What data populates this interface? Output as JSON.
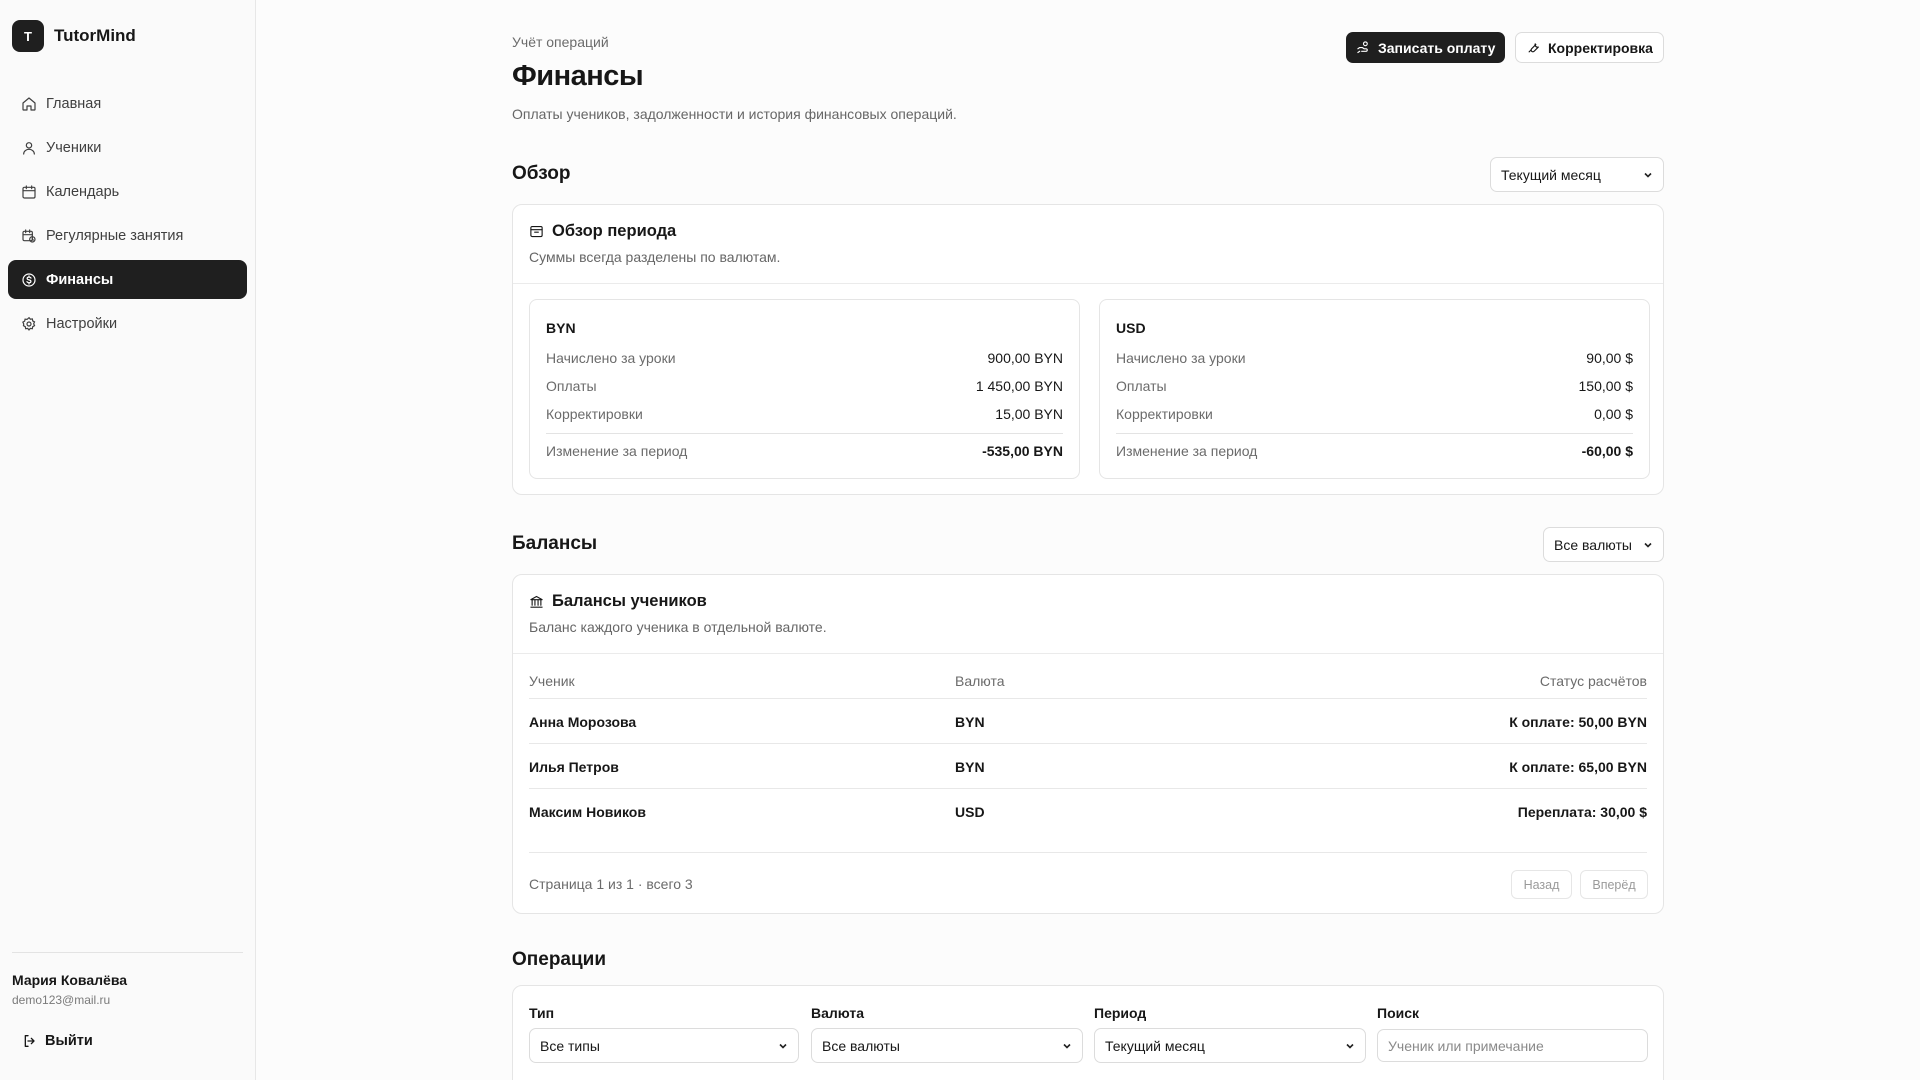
{
  "app": {
    "logo_letter": "T",
    "name": "TutorMind"
  },
  "sidebar": {
    "items": [
      {
        "label": "Главная",
        "icon": "home-icon"
      },
      {
        "label": "Ученики",
        "icon": "user-icon"
      },
      {
        "label": "Календарь",
        "icon": "calendar-icon"
      },
      {
        "label": "Регулярные занятия",
        "icon": "calendar-repeat-icon"
      },
      {
        "label": "Финансы",
        "icon": "dollar-circle-icon",
        "active": true
      },
      {
        "label": "Настройки",
        "icon": "gear-icon"
      }
    ],
    "user": {
      "name": "Мария Ковалёва",
      "email": "demo123@mail.ru"
    },
    "logout_label": "Выйти"
  },
  "header": {
    "breadcrumb": "Учёт операций",
    "title": "Финансы",
    "subtitle": "Оплаты учеников, задолженности и история финансовых операций.",
    "record_payment_label": "Записать оплату",
    "adjustment_label": "Корректировка"
  },
  "overview": {
    "section_title": "Обзор",
    "period_select": "Текущий месяц",
    "card_title": "Обзор периода",
    "card_desc": "Суммы всегда разделены по валютам.",
    "currencies": [
      {
        "code": "BYN",
        "rows": [
          {
            "label": "Начислено за уроки",
            "value": "900,00 BYN"
          },
          {
            "label": "Оплаты",
            "value": "1 450,00 BYN"
          },
          {
            "label": "Корректировки",
            "value": "15,00 BYN"
          }
        ],
        "total_label": "Изменение за период",
        "total_value": "-535,00 BYN"
      },
      {
        "code": "USD",
        "rows": [
          {
            "label": "Начислено за уроки",
            "value": "90,00 $"
          },
          {
            "label": "Оплаты",
            "value": "150,00 $"
          },
          {
            "label": "Корректировки",
            "value": "0,00 $"
          }
        ],
        "total_label": "Изменение за период",
        "total_value": "-60,00 $"
      }
    ]
  },
  "balances": {
    "section_title": "Балансы",
    "currency_select": "Все валюты",
    "card_title": "Балансы учеников",
    "card_desc": "Баланс каждого ученика в отдельной валюте.",
    "columns": [
      "Ученик",
      "Валюта",
      "Статус расчётов"
    ],
    "rows": [
      {
        "student": "Анна Морозова",
        "currency": "BYN",
        "status": "К оплате: 50,00 BYN"
      },
      {
        "student": "Илья Петров",
        "currency": "BYN",
        "status": "К оплате: 65,00 BYN"
      },
      {
        "student": "Максим Новиков",
        "currency": "USD",
        "status": "Переплата: 30,00 $"
      }
    ],
    "pager_text": "Страница 1 из 1 · всего 3",
    "prev_label": "Назад",
    "next_label": "Вперёд"
  },
  "operations": {
    "section_title": "Операции",
    "filters": {
      "type_label": "Тип",
      "type_value": "Все типы",
      "currency_label": "Валюта",
      "currency_value": "Все валюты",
      "period_label": "Период",
      "period_value": "Текущий месяц",
      "search_label": "Поиск",
      "search_placeholder": "Ученик или примечание"
    }
  }
}
